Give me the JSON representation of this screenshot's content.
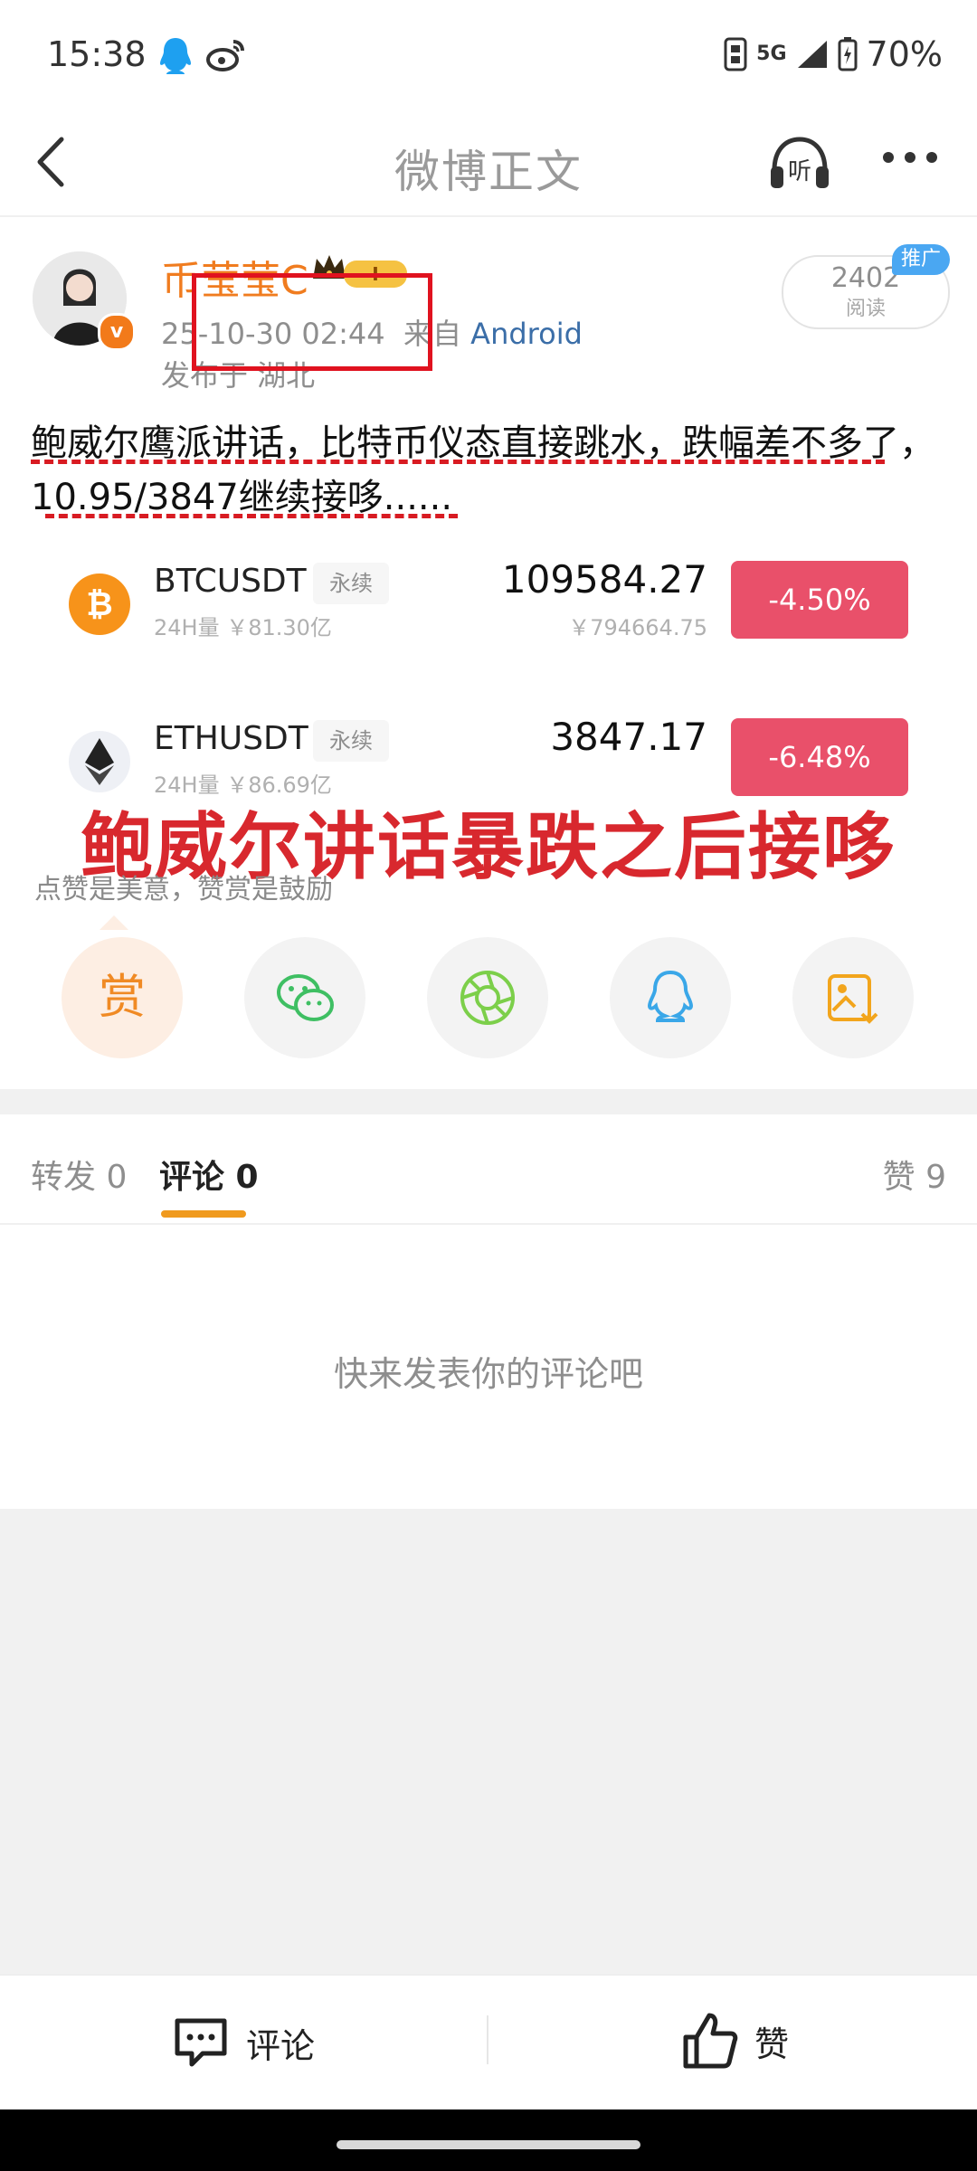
{
  "status_bar": {
    "time": "15:38",
    "network": "5G",
    "battery": "70%"
  },
  "header": {
    "title": "微博正文"
  },
  "author": {
    "name": "币莹莹C",
    "vip_tag": "I",
    "datetime": "25-10-30 02:44",
    "source_prefix": "来自",
    "source": "Android",
    "location": "发布于 湖北"
  },
  "read": {
    "count": "2402",
    "label": "阅读",
    "promo": "推广"
  },
  "post": {
    "text": "鲍威尔鹰派讲话，比特币仪态直接跳水，跌幅差不多了，10.95/3847继续接哆......"
  },
  "tickers": [
    {
      "symbol": "BTCUSDT",
      "tag": "永续",
      "volume": "24H量 ￥81.30亿",
      "price": "109584.27",
      "price_cny": "￥794664.75",
      "change": "-4.50%"
    },
    {
      "symbol": "ETHUSDT",
      "tag": "永续",
      "volume": "24H量 ￥86.69亿",
      "price": "3847.17",
      "price_cny": "",
      "change": "-6.48%"
    }
  ],
  "overlay_caption": "鲍威尔讲话暴跌之后接哆",
  "appreciate_text": "点赞是美意，赞赏是鼓励",
  "share": {
    "reward_label": "赏"
  },
  "tabs": {
    "repost": "转发 0",
    "comment": "评论 0",
    "like": "赞 9"
  },
  "empty_hint": "快来发表你的评论吧",
  "bottom_bar": {
    "comment": "评论",
    "like": "赞"
  },
  "colors": {
    "accent_orange": "#f07c1f",
    "change_red": "#e9506a",
    "annotation_red": "#d8282e",
    "link_blue": "#3b6ea8"
  }
}
